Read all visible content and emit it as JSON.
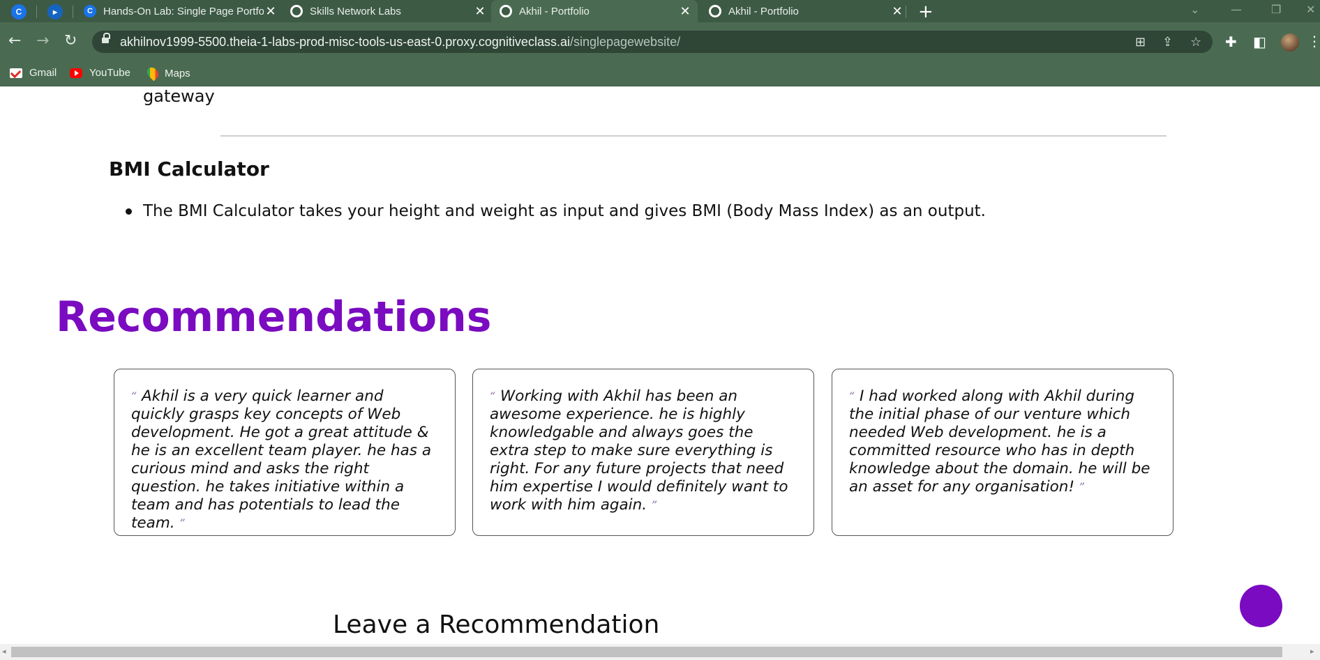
{
  "browser": {
    "tabs": [
      {
        "title": "Hands-On Lab: Single Page Portfolio"
      },
      {
        "title": "Skills Network Labs"
      },
      {
        "title": "Akhil - Portfolio"
      },
      {
        "title": "Akhil - Portfolio"
      }
    ],
    "active_tab_index": 2,
    "url_host": "akhilnov1999-5500.theia-1-labs-prod-misc-tools-us-east-0.proxy.cognitiveclass.ai",
    "url_path": "/singlepagewebsite/",
    "bookmarks": [
      {
        "label": "Gmail"
      },
      {
        "label": "YouTube"
      },
      {
        "label": "Maps"
      }
    ],
    "colors": {
      "chrome": "#4a6b52",
      "accent": "#7a0bc0"
    }
  },
  "page": {
    "previous_project_tail": "gateway",
    "project": {
      "title": "BMI Calculator",
      "description": "The BMI Calculator takes your height and weight as input and gives BMI (Body Mass Index) as an output."
    },
    "recommendations": {
      "heading": "Recommendations",
      "open_quote": "“",
      "close_quote": "”",
      "items": [
        {
          "text": "Akhil is a very quick learner and quickly grasps key concepts of Web development. He got a great attitude & he is an excellent team player. he has a curious mind and asks the right question. he takes initiative within a team and has potentials to lead the team."
        },
        {
          "text": "Working with Akhil has been an awesome experience. he is highly knowledgable and always goes the extra step to make sure everything is right. For any future projects that need him expertise I would definitely want to work with him again."
        },
        {
          "text": "I had worked along with Akhil during the initial phase of our venture which needed Web development. he is a committed resource who has in depth knowledge about the domain. he will be an asset for any organisation!"
        }
      ]
    },
    "leave_recommendation_heading": "Leave a Recommendation"
  }
}
